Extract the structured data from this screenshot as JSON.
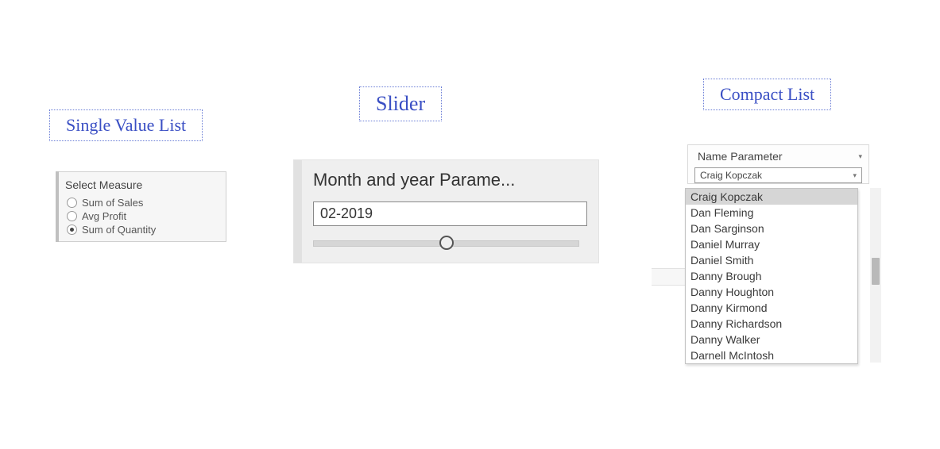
{
  "annotations": {
    "single_value_list": "Single Value List",
    "slider": "Slider",
    "compact_list": "Compact List"
  },
  "single_value_list": {
    "title": "Select Measure",
    "options": [
      {
        "label": "Sum of Sales",
        "checked": false
      },
      {
        "label": "Avg Profit",
        "checked": false
      },
      {
        "label": "Sum of Quantity",
        "checked": true
      }
    ]
  },
  "slider": {
    "title": "Month and year Parame...",
    "value": "02-2019"
  },
  "compact_list": {
    "title": "Name Parameter",
    "selected": "Craig Kopczak",
    "options": [
      "Craig Kopczak",
      "Dan Fleming",
      "Dan Sarginson",
      "Daniel Murray",
      "Daniel Smith",
      "Danny Brough",
      "Danny Houghton",
      "Danny Kirmond",
      "Danny Richardson",
      "Danny Walker",
      "Darnell McIntosh"
    ]
  }
}
